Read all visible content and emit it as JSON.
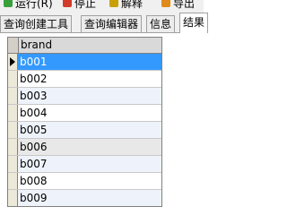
{
  "toolbar": {
    "run_label": "运行(R)",
    "stop_label": "停止",
    "explain_label": "解释",
    "export_label": "导出"
  },
  "tabs": [
    {
      "label": "查询创建工具"
    },
    {
      "label": "查询编辑器"
    },
    {
      "label": "信息"
    },
    {
      "label": "结果"
    }
  ],
  "grid": {
    "column_header": "brand",
    "rows": [
      "b001",
      "b002",
      "b003",
      "b004",
      "b005",
      "b006",
      "b007",
      "b008",
      "b009"
    ],
    "selected_index": 0
  },
  "colors": {
    "selected_row": "#3399ff",
    "alt_row": "#eef3fb"
  }
}
